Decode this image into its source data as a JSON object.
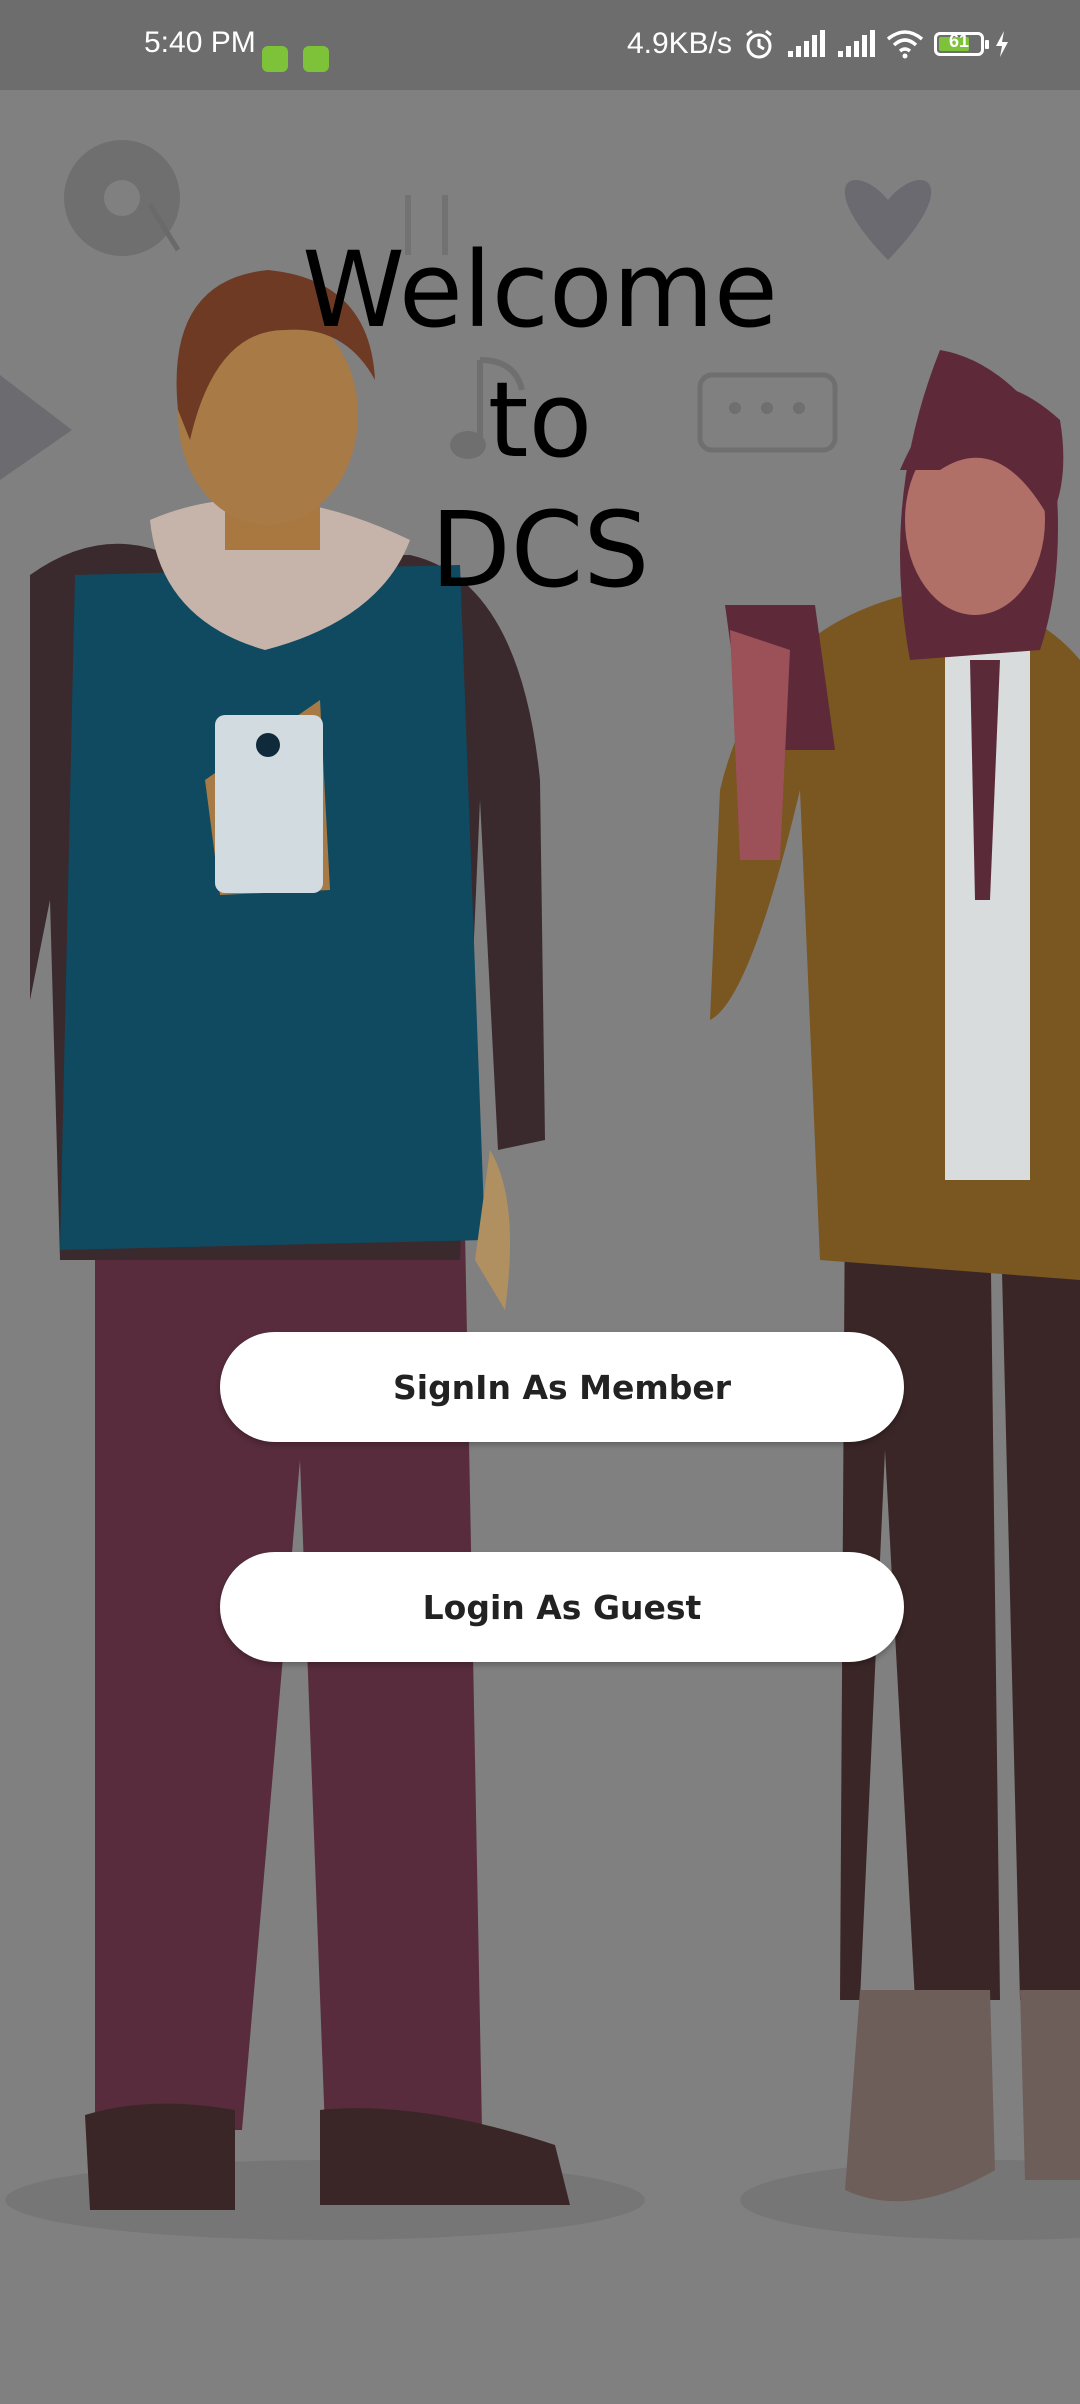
{
  "status_bar": {
    "time": "5:40 PM",
    "network_speed": "4.9KB/s",
    "battery_level": "61",
    "icons": [
      "app-icon",
      "app-icon",
      "alarm-icon",
      "signal-icon",
      "signal-icon",
      "wifi-icon",
      "battery-icon",
      "charging-icon"
    ]
  },
  "welcome": {
    "line1": "Welcome",
    "line2": "to",
    "line3": "DCS"
  },
  "buttons": {
    "member_label": "SignIn As Member",
    "guest_label": "Login As Guest"
  },
  "colors": {
    "overlay": "#808080",
    "button_bg": "#ffffff",
    "title_text": "#000000"
  }
}
